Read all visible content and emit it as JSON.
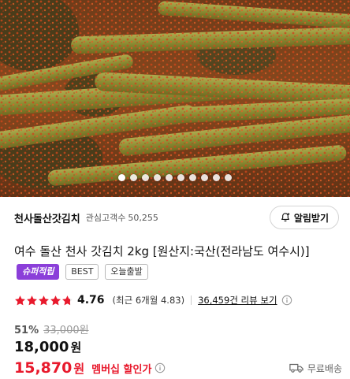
{
  "hero": {
    "image_subject": "kimchi-photo",
    "carousel_total": 10,
    "carousel_active": 1
  },
  "seller": {
    "name": "천사돌산갓김치",
    "interest_label": "관심고객수",
    "interest_count": "50,255",
    "follow_label": "알림받기"
  },
  "product": {
    "title": "여수 돌산 천사 갓김치 2kg [원산지:국산(전라남도 여수시)]",
    "badges": {
      "super": "슈퍼적립",
      "best": "BEST",
      "today": "오늘출발"
    }
  },
  "rating": {
    "score": "4.76",
    "stars_filled": 4.76,
    "recent": "(최근 6개월 4.83)",
    "reviews": "36,459건 리뷰 보기"
  },
  "price": {
    "discount_rate": "51%",
    "original": "33,000원",
    "sale": "18,000",
    "sale_unit": "원",
    "member": "15,870",
    "member_unit": "원",
    "member_label": "멤버십 할인가",
    "shipping": "무료배송"
  },
  "colors": {
    "accent_red": "#e8192c",
    "super_badge": "#8b3fd9",
    "star": "#e8192c"
  }
}
